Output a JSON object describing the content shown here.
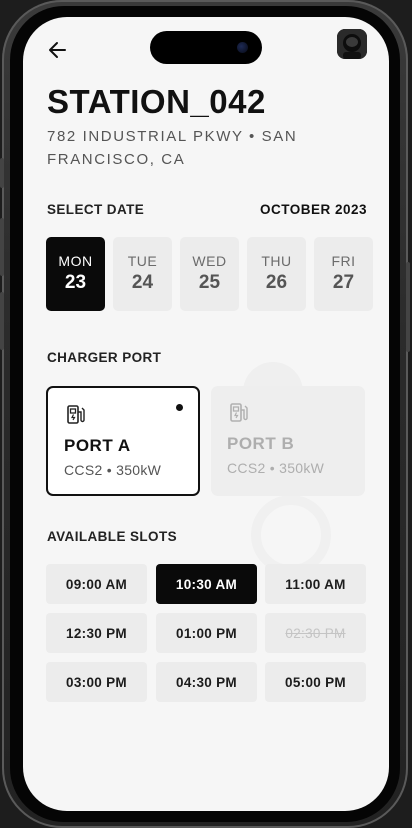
{
  "header": {
    "title": "STATION_042",
    "address": "782 INDUSTRIAL PKWY • SAN FRANCISCO, CA"
  },
  "icons": {
    "back": "arrow-left-icon",
    "avatar": "user-avatar",
    "plug": "ev-charger-icon"
  },
  "date_section": {
    "label": "SELECT DATE",
    "month": "OCTOBER 2023",
    "days": [
      {
        "dow": "MON",
        "num": "23",
        "selected": true
      },
      {
        "dow": "TUE",
        "num": "24",
        "selected": false
      },
      {
        "dow": "WED",
        "num": "25",
        "selected": false
      },
      {
        "dow": "THU",
        "num": "26",
        "selected": false
      },
      {
        "dow": "FRI",
        "num": "27",
        "selected": false
      }
    ]
  },
  "port_section": {
    "label": "CHARGER PORT",
    "ports": [
      {
        "name": "PORT A",
        "spec": "CCS2 • 350kW",
        "selected": true
      },
      {
        "name": "PORT B",
        "spec": "CCS2 • 350kW",
        "selected": false
      }
    ]
  },
  "slots_section": {
    "label": "AVAILABLE SLOTS",
    "slots": [
      {
        "time": "09:00 AM",
        "state": "available"
      },
      {
        "time": "10:30 AM",
        "state": "selected"
      },
      {
        "time": "11:00 AM",
        "state": "available"
      },
      {
        "time": "12:30 PM",
        "state": "available"
      },
      {
        "time": "01:00 PM",
        "state": "available"
      },
      {
        "time": "02:30 PM",
        "state": "unavailable"
      },
      {
        "time": "03:00 PM",
        "state": "available"
      },
      {
        "time": "04:30 PM",
        "state": "available"
      },
      {
        "time": "05:00 PM",
        "state": "available"
      }
    ]
  },
  "colors": {
    "accent": "#0a0a0a",
    "background": "#f6f6f6",
    "tile": "#ececec",
    "muted_text": "#555555"
  }
}
